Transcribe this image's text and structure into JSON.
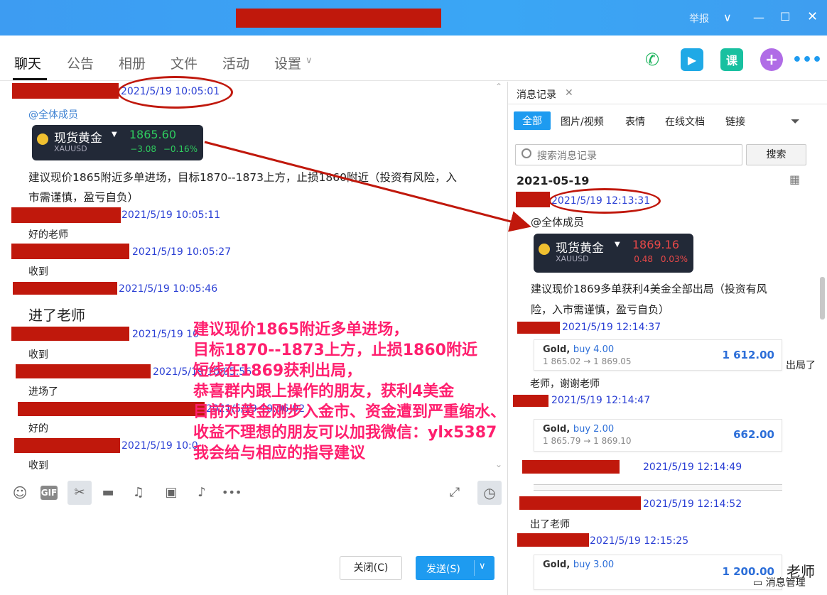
{
  "titlebar": {
    "report_label": "举报"
  },
  "tabs": [
    "聊天",
    "公告",
    "相册",
    "文件",
    "活动",
    "设置"
  ],
  "right_icons": {
    "course_label": "课"
  },
  "chat": {
    "m1_ts": "2021/5/19 10:05:01",
    "mention": "@全体成员",
    "ticker1": {
      "name": "现货黄金",
      "symbol": "XAUUSD",
      "price": "1865.60",
      "change": "−3.08",
      "pct": "−0.16%"
    },
    "m1_text_a": "建议现价1865附近多单进场，目标1870--1873上方，止损1860附近（投资有风险，入",
    "m1_text_b": "市需谨慎，盈亏自负）",
    "m2_ts": "2021/5/19 10:05:11",
    "m2_text": "好的老师",
    "m3_ts": "2021/5/19 10:05:27",
    "m3_text": "收到",
    "m4_ts": "2021/5/19 10:05:46",
    "m4_text": "进了老师",
    "m5_ts": "2021/5/19 10",
    "m5_text": "收到",
    "m6_ts": "2021/5/19 10:05:56",
    "m6_text": "进场了",
    "m7_ts": "2021/5/19 10:06:02",
    "m7_text": "好的",
    "m8_ts": "2021/5/19 10:0",
    "m8_text": "收到"
  },
  "overlay": [
    "建议现价1865附近多单进场，",
    "目标1870--1873上方，止损1860附近",
    "短线在1869获利出局，",
    "恭喜群内跟上操作的朋友，获利4美金",
    "目前对黄金刚步入金市、资金遭到严重缩水、",
    "收益不理想的朋友可以加我微信：ylx5387",
    "我会给与相应的指导建议"
  ],
  "composer": {
    "close_label": "关闭(C)",
    "send_label": "发送(S)"
  },
  "history": {
    "title": "消息记录",
    "filters": [
      "全部",
      "图片/视频",
      "表情",
      "在线文档",
      "链接"
    ],
    "search_placeholder": "搜索消息记录",
    "search_button": "搜索",
    "date": "2021-05-19",
    "h1_ts": "2021/5/19 12:13:31",
    "mention": "@全体成员",
    "ticker2": {
      "name": "现货黄金",
      "symbol": "XAUUSD",
      "price": "1869.16",
      "change": "0.48",
      "pct": "0.03%"
    },
    "h1_text_a": "建议现价1869多单获利4美金全部出局（投资有风",
    "h1_text_b": "险，入市需谨慎，盈亏自负）",
    "h2_ts": "2021/5/19 12:14:37",
    "trade1": {
      "sym": "Gold,",
      "side": "buy 4.00",
      "range": "1 865.02 → 1 869.05",
      "amt": "1 612.00"
    },
    "h2_side": "出局了",
    "h2_text": "老师，谢谢老师",
    "h3_ts": "2021/5/19 12:14:47",
    "trade2": {
      "sym": "Gold,",
      "side": "buy 2.00",
      "range": "1 865.79 → 1 869.10",
      "amt": "662.00"
    },
    "h4_ts": "2021/5/19 12:14:49",
    "h5_ts": "2021/5/19 12:14:52",
    "h5_text": "出了老师",
    "h6_ts": "2021/5/19 12:15:25",
    "trade3": {
      "sym": "Gold,",
      "side": "buy 3.00",
      "amt": "1 200.00"
    },
    "h6_side": "老师",
    "manager": "消息管理"
  }
}
